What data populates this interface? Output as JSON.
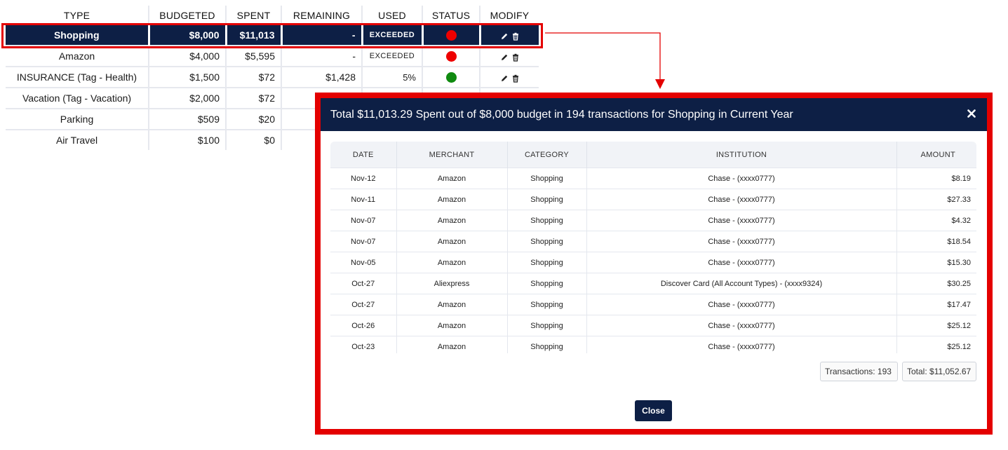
{
  "budget": {
    "headers": [
      "TYPE",
      "BUDGETED",
      "SPENT",
      "REMAINING",
      "USED",
      "STATUS",
      "MODIFY"
    ],
    "rows": [
      {
        "type": "Shopping",
        "budgeted": "$8,000",
        "spent": "$11,013",
        "remaining": "-",
        "used": "EXCEEDED",
        "status": "red",
        "selected": true
      },
      {
        "type": "Amazon",
        "budgeted": "$4,000",
        "spent": "$5,595",
        "remaining": "-",
        "used": "EXCEEDED",
        "status": "red",
        "selected": false
      },
      {
        "type": "INSURANCE (Tag - Health)",
        "budgeted": "$1,500",
        "spent": "$72",
        "remaining": "$1,428",
        "used": "5%",
        "status": "green",
        "selected": false
      },
      {
        "type": "Vacation (Tag - Vacation)",
        "budgeted": "$2,000",
        "spent": "$72",
        "remaining": "",
        "used": "",
        "status": "",
        "selected": false
      },
      {
        "type": "Parking",
        "budgeted": "$509",
        "spent": "$20",
        "remaining": "",
        "used": "",
        "status": "",
        "selected": false
      },
      {
        "type": "Air Travel",
        "budgeted": "$100",
        "spent": "$0",
        "remaining": "",
        "used": "",
        "status": "",
        "selected": false
      }
    ],
    "icons": {
      "edit": "pencil-icon",
      "delete": "trash-icon"
    },
    "colors": {
      "red": "#ee0000",
      "green": "#108a10",
      "navy": "#0d1f45"
    }
  },
  "modal": {
    "title": "Total $11,013.29 Spent out of $8,000 budget in 194 transactions for Shopping in Current Year",
    "close_icon": "close-icon",
    "columns": [
      "DATE",
      "MERCHANT",
      "CATEGORY",
      "INSTITUTION",
      "AMOUNT"
    ],
    "rows": [
      [
        "Nov-12",
        "Amazon",
        "Shopping",
        "Chase - (xxxx0777)",
        "$8.19"
      ],
      [
        "Nov-11",
        "Amazon",
        "Shopping",
        "Chase - (xxxx0777)",
        "$27.33"
      ],
      [
        "Nov-07",
        "Amazon",
        "Shopping",
        "Chase - (xxxx0777)",
        "$4.32"
      ],
      [
        "Nov-07",
        "Amazon",
        "Shopping",
        "Chase - (xxxx0777)",
        "$18.54"
      ],
      [
        "Nov-05",
        "Amazon",
        "Shopping",
        "Chase - (xxxx0777)",
        "$15.30"
      ],
      [
        "Oct-27",
        "Aliexpress",
        "Shopping",
        "Discover Card (All Account Types) - (xxxx9324)",
        "$30.25"
      ],
      [
        "Oct-27",
        "Amazon",
        "Shopping",
        "Chase - (xxxx0777)",
        "$17.47"
      ],
      [
        "Oct-26",
        "Amazon",
        "Shopping",
        "Chase - (xxxx0777)",
        "$25.12"
      ],
      [
        "Oct-23",
        "Amazon",
        "Shopping",
        "Chase - (xxxx0777)",
        "$25.12"
      ]
    ],
    "transactions_label": "Transactions: 193",
    "total_label": "Total: $11,052.67",
    "close_button": "Close"
  }
}
